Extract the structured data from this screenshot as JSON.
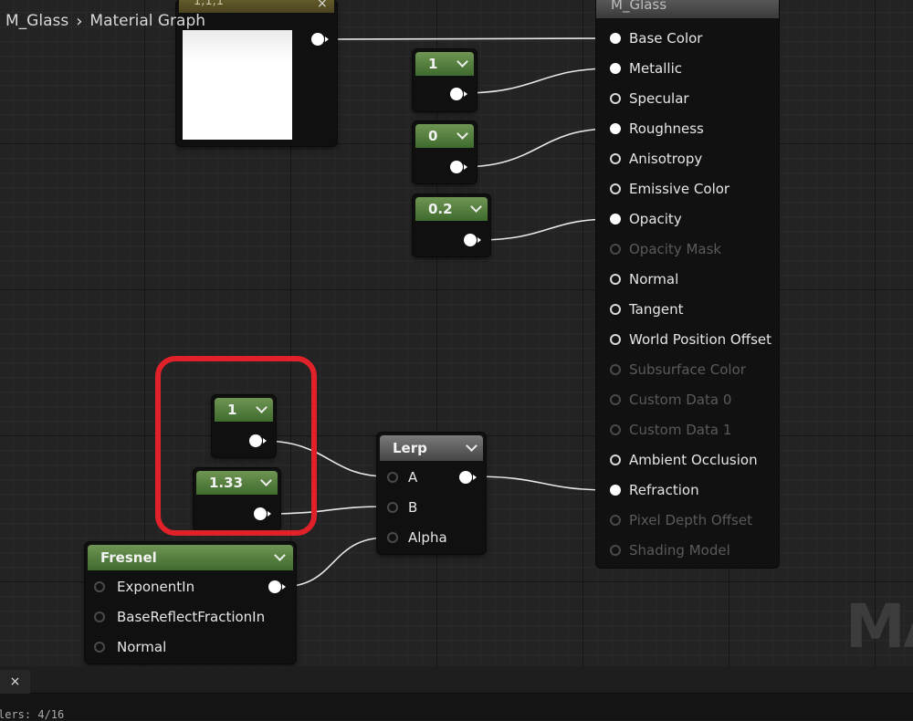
{
  "breadcrumb": {
    "root": "M_Glass",
    "separator": "›",
    "current": "Material Graph"
  },
  "texture_node": {
    "title": "1,1,1",
    "close": "×"
  },
  "main_node": {
    "title": "M_Glass",
    "inputs": [
      {
        "label": "Base Color",
        "state": "connected"
      },
      {
        "label": "Metallic",
        "state": "connected"
      },
      {
        "label": "Specular",
        "state": "open"
      },
      {
        "label": "Roughness",
        "state": "connected"
      },
      {
        "label": "Anisotropy",
        "state": "open"
      },
      {
        "label": "Emissive Color",
        "state": "open"
      },
      {
        "label": "Opacity",
        "state": "connected"
      },
      {
        "label": "Opacity Mask",
        "state": "disabled"
      },
      {
        "label": "Normal",
        "state": "open"
      },
      {
        "label": "Tangent",
        "state": "open"
      },
      {
        "label": "World Position Offset",
        "state": "open"
      },
      {
        "label": "Subsurface Color",
        "state": "disabled"
      },
      {
        "label": "Custom Data 0",
        "state": "disabled"
      },
      {
        "label": "Custom Data 1",
        "state": "disabled"
      },
      {
        "label": "Ambient Occlusion",
        "state": "open"
      },
      {
        "label": "Refraction",
        "state": "connected"
      },
      {
        "label": "Pixel Depth Offset",
        "state": "disabled"
      },
      {
        "label": "Shading Model",
        "state": "disabled"
      }
    ]
  },
  "constants": {
    "metallic": "1",
    "roughness": "0",
    "opacity": "0.2",
    "lerp_a": "1",
    "lerp_b": "1.33"
  },
  "lerp_node": {
    "title": "Lerp",
    "inputs": [
      "A",
      "B",
      "Alpha"
    ]
  },
  "fresnel_node": {
    "title": "Fresnel",
    "inputs": [
      "ExponentIn",
      "BaseReflectFractionIn",
      "Normal"
    ]
  },
  "watermark": "MA",
  "bottom_panel": {
    "tab_close": "×",
    "stats_text": "lers: 4/16"
  },
  "colors": {
    "constant_header": "#5a8a42",
    "highlight": "#e0212a",
    "pin_connected": "#ffffff"
  }
}
